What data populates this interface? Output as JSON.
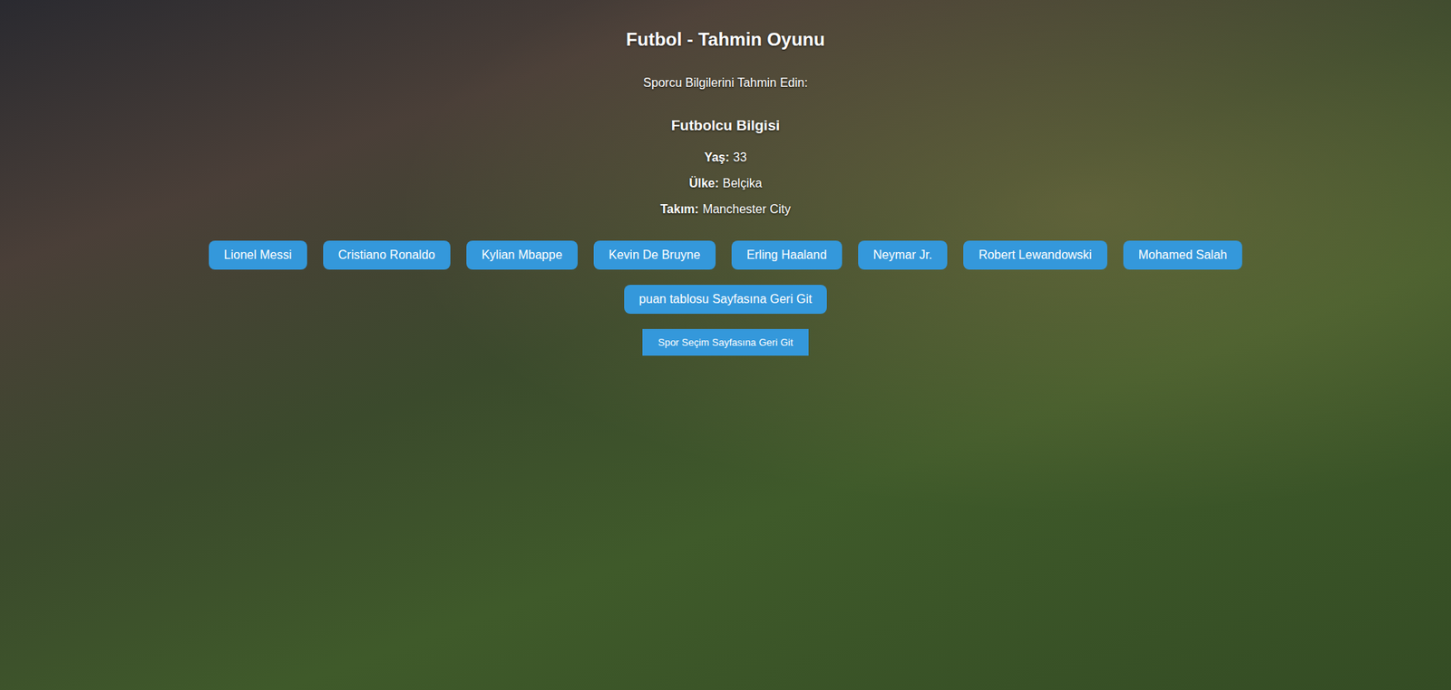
{
  "title": "Futbol - Tahmin Oyunu",
  "prompt": "Sporcu Bilgilerini Tahmin Edin:",
  "info": {
    "heading": "Futbolcu Bilgisi",
    "fields": [
      {
        "label": "Yaş:",
        "value": "33"
      },
      {
        "label": "Ülke:",
        "value": "Belçika"
      },
      {
        "label": "Takım:",
        "value": "Manchester City"
      }
    ]
  },
  "options": [
    "Lionel Messi",
    "Cristiano Ronaldo",
    "Kylian Mbappe",
    "Kevin De Bruyne",
    "Erling Haaland",
    "Neymar Jr.",
    "Robert Lewandowski",
    "Mohamed Salah"
  ],
  "buttons": [
    {
      "label": "puan tablosu Sayfasına Geri Git",
      "kind": "primary"
    },
    {
      "label": "Spor Seçim Sayfasına Geri Git",
      "kind": "secondary"
    }
  ]
}
